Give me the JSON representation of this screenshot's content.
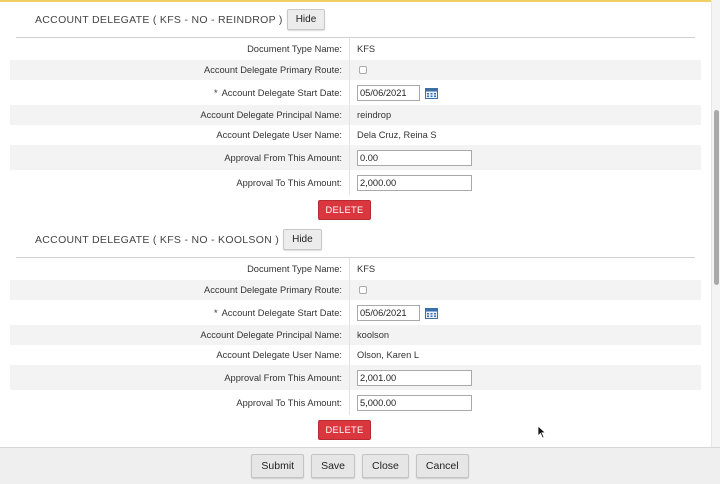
{
  "sections": [
    {
      "title": "ACCOUNT DELEGATE ( KFS - NO - REINDROP )",
      "hide_label": "Hide",
      "fields": {
        "document_type": {
          "label": "Document Type Name:",
          "value": "KFS"
        },
        "primary_route": {
          "label": "Account Delegate Primary Route:",
          "checked": false
        },
        "start_date": {
          "required_mark": "*",
          "label": "Account Delegate Start Date:",
          "value": "05/06/2021"
        },
        "principal_name": {
          "label": "Account Delegate Principal Name:",
          "value": "reindrop"
        },
        "user_name": {
          "label": "Account Delegate User Name:",
          "value": "Dela Cruz, Reina S"
        },
        "from_amount": {
          "label": "Approval From This Amount:",
          "value": "0.00"
        },
        "to_amount": {
          "label": "Approval To This Amount:",
          "value": "2,000.00"
        }
      },
      "delete_label": "DELETE"
    },
    {
      "title": "ACCOUNT DELEGATE ( KFS - NO - KOOLSON )",
      "hide_label": "Hide",
      "fields": {
        "document_type": {
          "label": "Document Type Name:",
          "value": "KFS"
        },
        "primary_route": {
          "label": "Account Delegate Primary Route:",
          "checked": false
        },
        "start_date": {
          "required_mark": "*",
          "label": "Account Delegate Start Date:",
          "value": "05/06/2021"
        },
        "principal_name": {
          "label": "Account Delegate Principal Name:",
          "value": "koolson"
        },
        "user_name": {
          "label": "Account Delegate User Name:",
          "value": "Olson, Karen L"
        },
        "from_amount": {
          "label": "Approval From This Amount:",
          "value": "2,001.00"
        },
        "to_amount": {
          "label": "Approval To This Amount:",
          "value": "5,000.00"
        }
      },
      "delete_label": "DELETE"
    }
  ],
  "footer": {
    "submit_label": "Submit",
    "save_label": "Save",
    "close_label": "Close",
    "cancel_label": "Cancel"
  },
  "icons": {
    "calendar": "calendar-icon",
    "cursor": "mouse-pointer-icon"
  },
  "colors": {
    "delete_button": "#d9363e",
    "alt_row": "#f3f3f3",
    "top_accent": "#f0d060"
  }
}
